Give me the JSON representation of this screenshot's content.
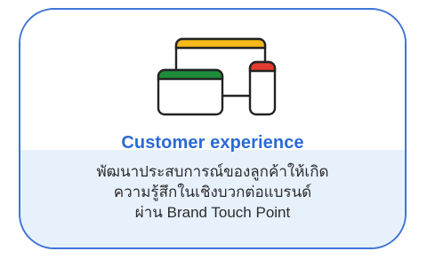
{
  "card": {
    "title": "Customer experience",
    "description_lines": [
      "พัฒนาประสบการณ์ของลูกค้าให้เกิด",
      "ความรู้สึกในเชิงบวกต่อแบรนด์",
      "ผ่าน Brand Touch Point"
    ],
    "icon": "devices-icon"
  },
  "colors": {
    "border": "#3f73d8",
    "title": "#2b6ad6",
    "bottom_background": "#e7f1fc",
    "desktop_bar": "#f6b91a",
    "tablet_bar": "#1e8d3b",
    "phone_bar": "#e23c2e"
  }
}
